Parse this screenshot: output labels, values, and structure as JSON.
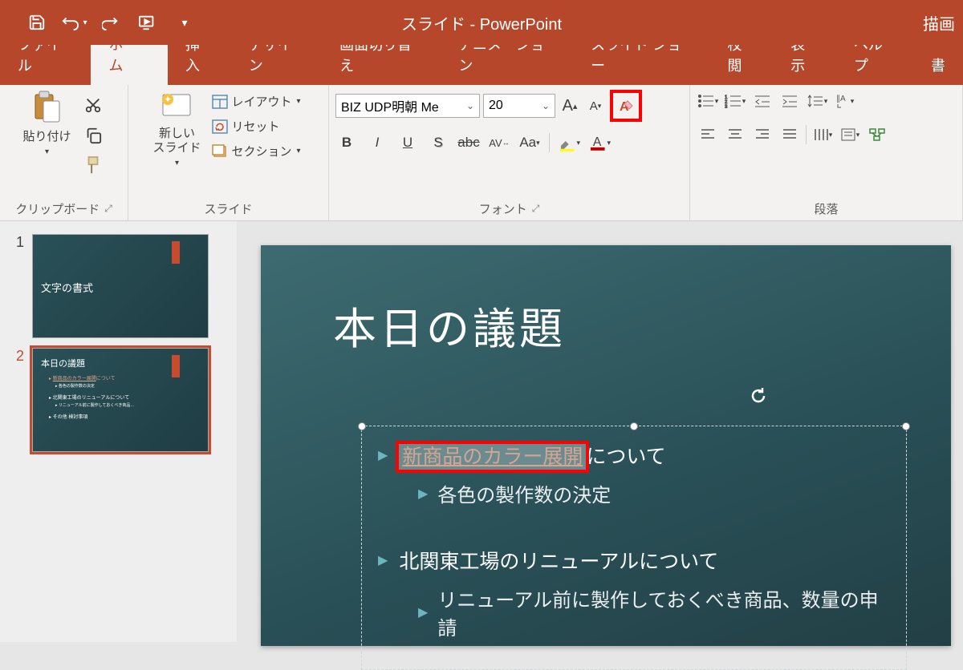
{
  "title": "スライド - PowerPoint",
  "rightLabel": "描画",
  "tabs": {
    "file": "ファイル",
    "home": "ホーム",
    "insert": "挿入",
    "design": "デザイン",
    "transitions": "画面切り替え",
    "animations": "アニメーション",
    "slideshow": "スライド ショー",
    "review": "校閲",
    "view": "表示",
    "help": "ヘルプ",
    "format": "書"
  },
  "groups": {
    "clipboard": {
      "label": "クリップボード",
      "paste": "貼り付け"
    },
    "slides": {
      "label": "スライド",
      "newSlide": "新しい\nスライド",
      "layout": "レイアウト",
      "reset": "リセット",
      "section": "セクション"
    },
    "font": {
      "label": "フォント",
      "name": "BIZ UDP明朝 Me",
      "size": "20"
    },
    "paragraph": {
      "label": "段落"
    }
  },
  "thumbs": {
    "t1": {
      "num": "1",
      "title": "文字の書式"
    },
    "t2": {
      "num": "2",
      "title": "本日の議題"
    }
  },
  "slide": {
    "title": "本日の議題",
    "b1_sel": "新商品のカラー展開",
    "b1_rest": "について",
    "b1a": "各色の製作数の決定",
    "b2": "北関東工場のリニューアルについて",
    "b2a": "リニューアル前に製作しておくべき商品、数量の申請"
  }
}
